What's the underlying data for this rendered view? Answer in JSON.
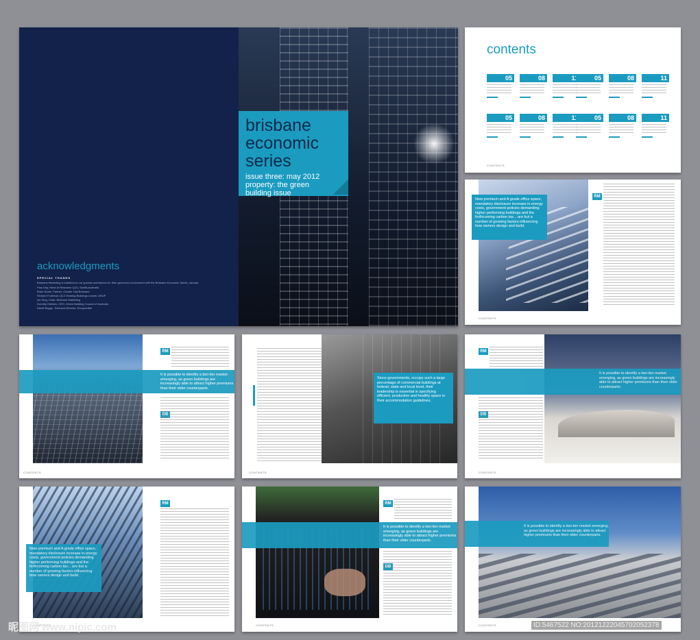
{
  "cover": {
    "title": "brisbane economic series",
    "subtitle": "issue three: may 2012 property: the green building issue",
    "ack_heading": "acknowledgments",
    "special_thanks_label": "SPECIAL THANKS",
    "ack_intro": "Brisbane Marketing is indebted to our special contributors for their generous involvement with the Brisbane Economic Series, namely:",
    "ack_names": [
      "Paul Day, Head of Research QLD, Savills Australia",
      "Brian Noble, Partner, Charter Hall Brisbane",
      "Richard Forthead, QLD Existing Buildings Leader, ARUP",
      "Ian Klug, Chair, Brisbane Marketing",
      "Dorothy Hobbes, CEO, Green Building Council of Australia",
      "David Boggs, Technical Director, Ecospecifier"
    ]
  },
  "contents": {
    "heading": "contents",
    "rows": [
      {
        "numbers": [
          "05",
          "08",
          "11",
          "05",
          "08",
          "11"
        ]
      },
      {
        "numbers": [
          "05",
          "08",
          "11",
          "05",
          "08",
          "11"
        ]
      }
    ],
    "footer": "CONTENTS"
  },
  "pages": {
    "rm": "RM",
    "db": "DB",
    "quote_a": "New premium and A grade office space, mandatory disclosure increase in energy costs, government policies demanding higher performing buildings and the forthcoming carbon tax... are but a number of growing factors influencing how owners design and build.",
    "quote_b": "It is possible to identify a two-tier market emerging, as green buildings are increasingly able to attract higher premiums than their older counterparts.",
    "quote_c": "Since governments, occupy such a large percentage of commercial buildings at federal, state and local level, their leadership is essential in specifying efficient, productive and healthy space in their accommodation guidelines.",
    "footer": "CONTENTS"
  },
  "watermark": {
    "left": "昵图网 www.nipic.com",
    "right": "ID:5467522 NO:20121222045702052378"
  }
}
